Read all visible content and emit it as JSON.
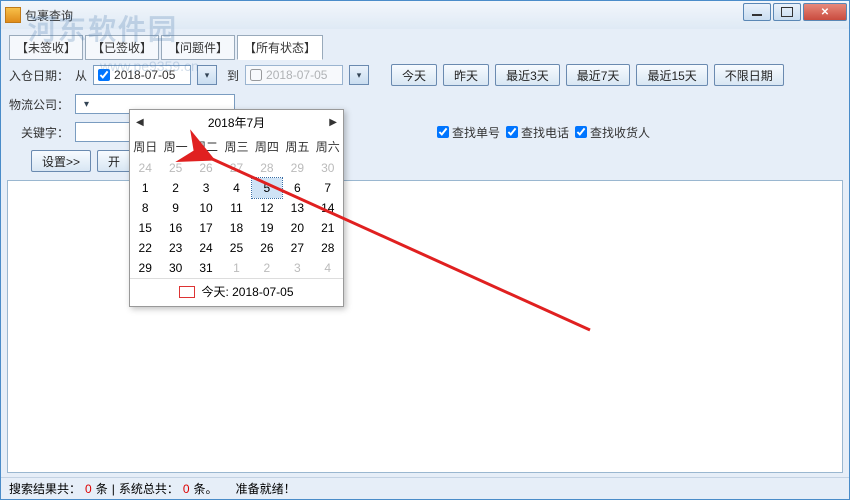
{
  "window": {
    "title": "包裹查询"
  },
  "watermark": {
    "main": "河东软件园",
    "url": "www.pe9359.cn"
  },
  "tabs": {
    "items": [
      "【未签收】",
      "【已签收】",
      "【问题件】",
      "【所有状态】"
    ],
    "active_index": 3
  },
  "daterow": {
    "label": "入仓日期：",
    "from_prefix": "从",
    "from_value": "2018-07-05",
    "to_prefix": "到",
    "to_value": "2018-07-05",
    "buttons": [
      "今天",
      "昨天",
      "最近3天",
      "最近7天",
      "最近15天",
      "不限日期"
    ]
  },
  "logirow": {
    "label": "物流公司："
  },
  "kwrow": {
    "label": "关键字：",
    "chk_order": "查找单号",
    "chk_phone": "查找电话",
    "chk_receiver": "查找收货人"
  },
  "actions": {
    "settings": "设置>>",
    "start": "开"
  },
  "calendar": {
    "title": "2018年7月",
    "weekdays": [
      "周日",
      "周一",
      "周二",
      "周三",
      "周四",
      "周五",
      "周六"
    ],
    "cells": [
      {
        "d": "24",
        "out": true
      },
      {
        "d": "25",
        "out": true
      },
      {
        "d": "26",
        "out": true
      },
      {
        "d": "27",
        "out": true
      },
      {
        "d": "28",
        "out": true
      },
      {
        "d": "29",
        "out": true
      },
      {
        "d": "30",
        "out": true
      },
      {
        "d": "1"
      },
      {
        "d": "2"
      },
      {
        "d": "3"
      },
      {
        "d": "4"
      },
      {
        "d": "5",
        "sel": true
      },
      {
        "d": "6"
      },
      {
        "d": "7"
      },
      {
        "d": "8"
      },
      {
        "d": "9"
      },
      {
        "d": "10"
      },
      {
        "d": "11"
      },
      {
        "d": "12"
      },
      {
        "d": "13"
      },
      {
        "d": "14"
      },
      {
        "d": "15"
      },
      {
        "d": "16"
      },
      {
        "d": "17"
      },
      {
        "d": "18"
      },
      {
        "d": "19"
      },
      {
        "d": "20"
      },
      {
        "d": "21"
      },
      {
        "d": "22"
      },
      {
        "d": "23"
      },
      {
        "d": "24"
      },
      {
        "d": "25"
      },
      {
        "d": "26"
      },
      {
        "d": "27"
      },
      {
        "d": "28"
      },
      {
        "d": "29"
      },
      {
        "d": "30"
      },
      {
        "d": "31"
      },
      {
        "d": "1",
        "out": true
      },
      {
        "d": "2",
        "out": true
      },
      {
        "d": "3",
        "out": true
      },
      {
        "d": "4",
        "out": true
      }
    ],
    "today_label": "今天: 2018-07-05"
  },
  "status": {
    "seg1a": "搜索结果共：",
    "seg1b": "0",
    "seg1c": " 条",
    "sep": " | ",
    "seg2a": "系统总共：",
    "seg2b": "0",
    "seg2c": " 条。",
    "ready": "准备就绪！"
  }
}
